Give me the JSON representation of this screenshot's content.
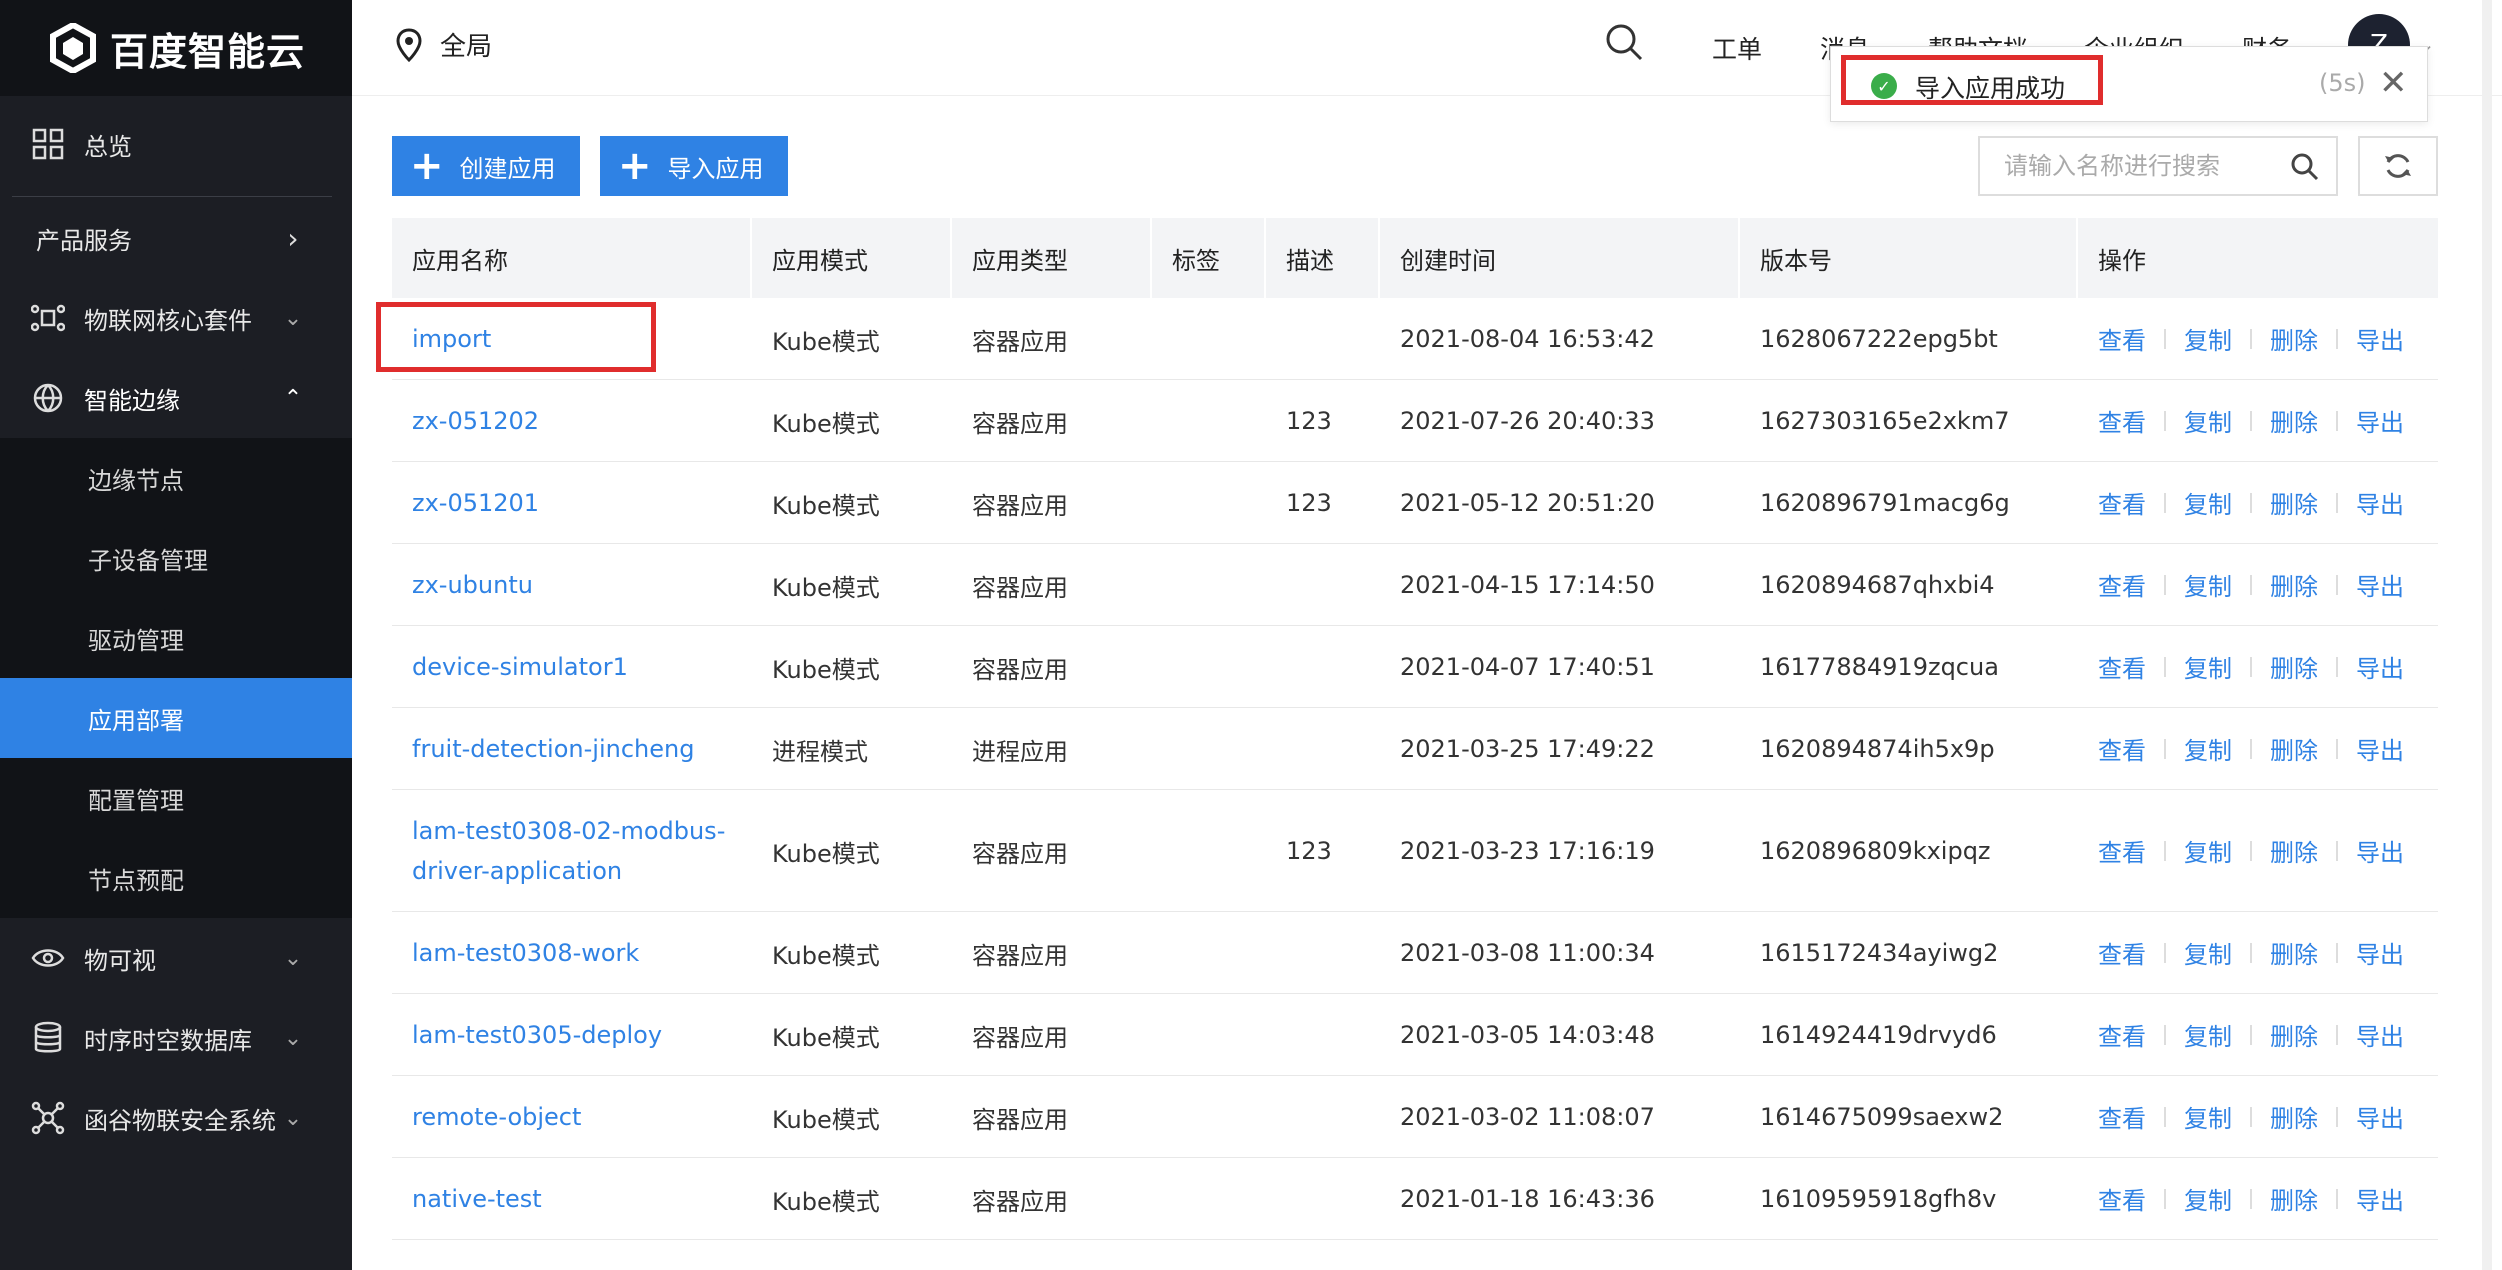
{
  "sidebar": {
    "brand": "百度智能云",
    "overview": "总览",
    "products": "产品服务",
    "iot_suite": "物联网核心套件",
    "edge": "智能边缘",
    "edge_items": [
      "边缘节点",
      "子设备管理",
      "驱动管理",
      "应用部署",
      "配置管理",
      "节点预配"
    ],
    "active_item": "应用部署",
    "visual": "物可视",
    "tsdb": "时序时空数据库",
    "security": "函谷物联安全系统"
  },
  "header": {
    "region": "全局",
    "links": [
      "工单",
      "消息",
      "帮助文档",
      "企业组织",
      "财务"
    ],
    "avatar": "Z"
  },
  "toast": {
    "text": "导入应用成功",
    "countdown": "(5s)",
    "accent": "#3aad4a"
  },
  "toolbar": {
    "create_label": "创建应用",
    "import_label": "导入应用",
    "search_placeholder": "请输入名称进行搜索"
  },
  "table": {
    "columns": [
      "应用名称",
      "应用模式",
      "应用类型",
      "标签",
      "描述",
      "创建时间",
      "版本号",
      "操作"
    ],
    "actions": [
      "查看",
      "复制",
      "删除",
      "导出"
    ],
    "rows": [
      {
        "name": "import",
        "mode": "Kube模式",
        "type": "容器应用",
        "tag": "",
        "desc": "",
        "created": "2021-08-04 16:53:42",
        "version": "1628067222epg5bt"
      },
      {
        "name": "zx-051202",
        "mode": "Kube模式",
        "type": "容器应用",
        "tag": "",
        "desc": "123",
        "created": "2021-07-26 20:40:33",
        "version": "1627303165e2xkm7"
      },
      {
        "name": "zx-051201",
        "mode": "Kube模式",
        "type": "容器应用",
        "tag": "",
        "desc": "123",
        "created": "2021-05-12 20:51:20",
        "version": "1620896791macg6g"
      },
      {
        "name": "zx-ubuntu",
        "mode": "Kube模式",
        "type": "容器应用",
        "tag": "",
        "desc": "",
        "created": "2021-04-15 17:14:50",
        "version": "1620894687qhxbi4"
      },
      {
        "name": "device-simulator1",
        "mode": "Kube模式",
        "type": "容器应用",
        "tag": "",
        "desc": "",
        "created": "2021-04-07 17:40:51",
        "version": "16177884919zqcua"
      },
      {
        "name": "fruit-detection-jincheng",
        "mode": "进程模式",
        "type": "进程应用",
        "tag": "",
        "desc": "",
        "created": "2021-03-25 17:49:22",
        "version": "1620894874ih5x9p"
      },
      {
        "name": "lam-test0308-02-modbus-driver-application",
        "mode": "Kube模式",
        "type": "容器应用",
        "tag": "",
        "desc": "123",
        "created": "2021-03-23 17:16:19",
        "version": "1620896809kxipqz"
      },
      {
        "name": "lam-test0308-work",
        "mode": "Kube模式",
        "type": "容器应用",
        "tag": "",
        "desc": "",
        "created": "2021-03-08 11:00:34",
        "version": "1615172434ayiwg2"
      },
      {
        "name": "lam-test0305-deploy",
        "mode": "Kube模式",
        "type": "容器应用",
        "tag": "",
        "desc": "",
        "created": "2021-03-05 14:03:48",
        "version": "1614924419drvyd6"
      },
      {
        "name": "remote-object",
        "mode": "Kube模式",
        "type": "容器应用",
        "tag": "",
        "desc": "",
        "created": "2021-03-02 11:08:07",
        "version": "1614675099saexw2"
      },
      {
        "name": "native-test",
        "mode": "Kube模式",
        "type": "容器应用",
        "tag": "",
        "desc": "",
        "created": "2021-01-18 16:43:36",
        "version": "16109595918gfh8v"
      }
    ]
  },
  "colors": {
    "brand": "#2f82e4",
    "sidebar": "#1c1e24",
    "highlight": "#e02d2d"
  }
}
